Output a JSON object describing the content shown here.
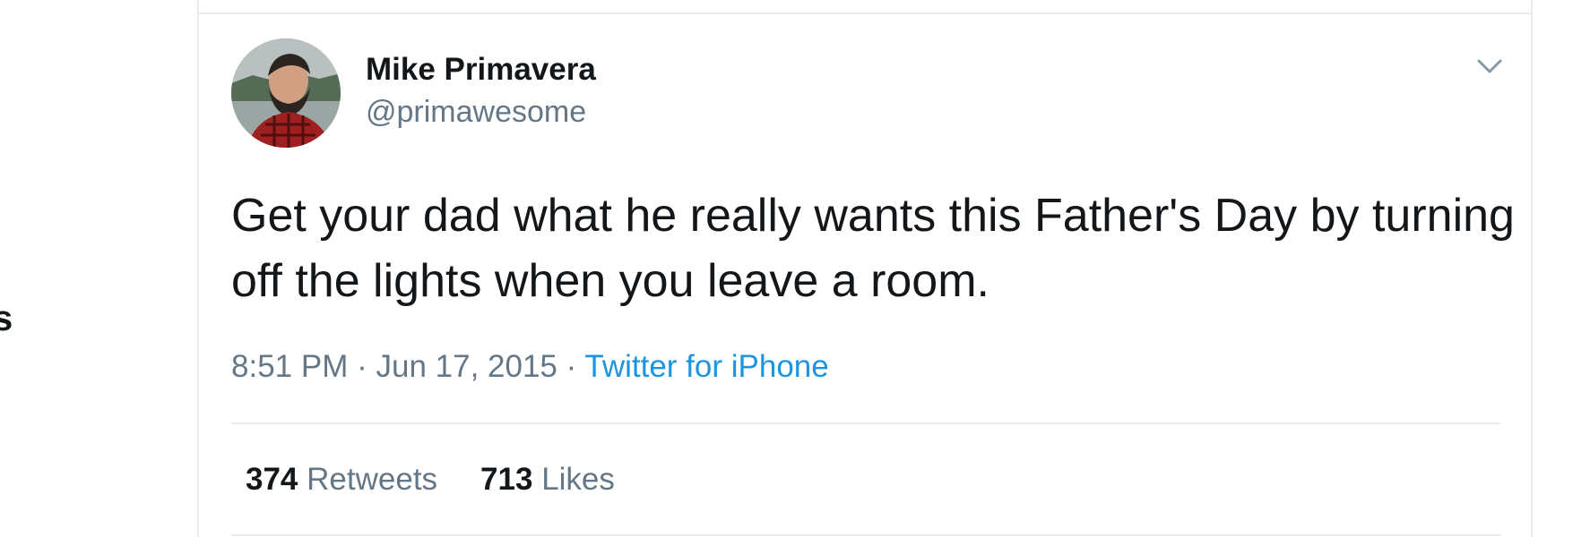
{
  "sidebar": {
    "partial_text": "s"
  },
  "tweet": {
    "author": {
      "display_name": "Mike Primavera",
      "handle": "@primawesome",
      "avatar_icon": "user-avatar-photo"
    },
    "menu_icon": "chevron-down-icon",
    "text": "Get your dad what he really wants this Father's Day by turning off the lights when you leave a room.",
    "time": "8:51 PM",
    "date": "Jun 17, 2015",
    "separator": "·",
    "source": "Twitter for iPhone",
    "stats": {
      "retweets_count": "374",
      "retweets_label": "Retweets",
      "likes_count": "713",
      "likes_label": "Likes"
    }
  },
  "colors": {
    "primary_text": "#14171a",
    "secondary_text": "#657786",
    "link": "#1b95e0",
    "border": "#e6ecf0"
  }
}
